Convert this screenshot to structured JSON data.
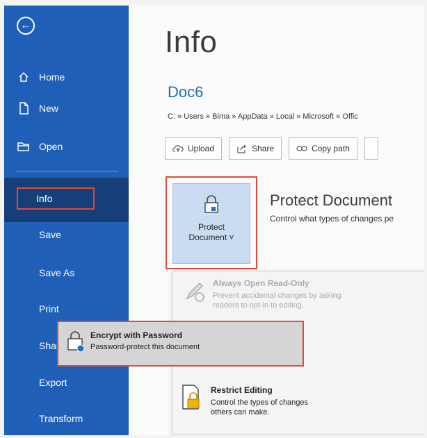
{
  "sidebar": {
    "back_glyph": "←",
    "items": [
      {
        "label": "Home",
        "icon": "home-icon"
      },
      {
        "label": "New",
        "icon": "new-document-icon"
      },
      {
        "label": "Open",
        "icon": "open-folder-icon"
      },
      {
        "label": "Info",
        "active": true
      },
      {
        "label": "Save"
      },
      {
        "label": "Save As"
      },
      {
        "label": "Print"
      },
      {
        "label": "Share"
      },
      {
        "label": "Export"
      },
      {
        "label": "Transform"
      }
    ]
  },
  "main": {
    "title": "Info",
    "doc_name": "Doc6",
    "path": "C: » Users » Bima » AppData » Local » Microsoft » Offic",
    "buttons": [
      {
        "label": "Upload",
        "icon": "cloud-upload-icon"
      },
      {
        "label": "Share",
        "icon": "share-icon"
      },
      {
        "label": "Copy path",
        "icon": "link-icon"
      }
    ],
    "protect": {
      "button_label_1": "Protect",
      "button_label_2": "Document ˅",
      "heading": "Protect Document",
      "description": "Control what types of changes pe"
    },
    "dropdown": [
      {
        "title": "Always Open Read-Only",
        "desc": "Prevent accidental changes by asking readers to opt-in to editing.",
        "disabled": true,
        "icon": "pencil-disabled-icon"
      },
      {
        "title": "Encrypt with Password",
        "desc": "Password-protect this document",
        "highlighted": true,
        "icon": "lock-key-icon"
      },
      {
        "title": "Restrict Editing",
        "desc": "Control the types of changes others can make.",
        "icon": "restrict-editing-icon"
      }
    ]
  },
  "colors": {
    "sidebar": "#1f5fb8",
    "sidebar_active": "#163f7a",
    "highlight_border": "#e04a3a",
    "accent_text": "#2a6ab8"
  }
}
